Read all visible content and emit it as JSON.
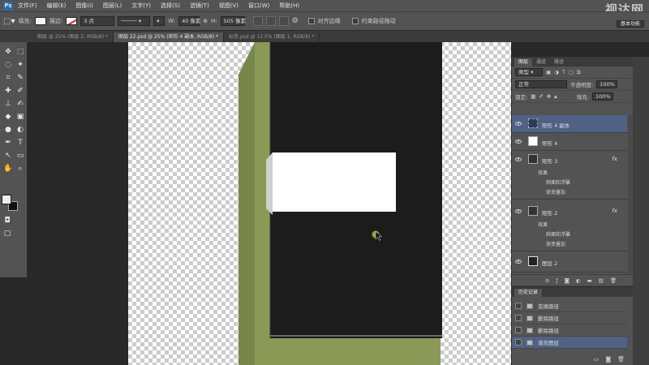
{
  "menu": {
    "logo": "Ps",
    "items": [
      "文件(F)",
      "编辑(E)",
      "图像(I)",
      "图层(L)",
      "文字(Y)",
      "选择(S)",
      "滤镜(T)",
      "视图(V)",
      "窗口(W)",
      "帮助(H)"
    ]
  },
  "watermark": "视达网",
  "options": {
    "fill_label": "填充:",
    "stroke_label": "描边:",
    "stroke_size": "3 点",
    "w_label": "W:",
    "w_value": "40 像素",
    "h_label": "H:",
    "h_value": "505 像素",
    "align_edges": "对齐边缘",
    "constrain_path": "约束路径拖动",
    "workspace": "基本功能"
  },
  "tabs": [
    "图层 @ 25% (图层 2, RGB/8) *",
    "图层 22.psd @ 25% (矩形 4 副本, RGB/8) *",
    "标签.psd @ 12.5% (图层 1, RGB/8) *"
  ],
  "layers_panel": {
    "tabs": [
      "图层",
      "通道",
      "路径"
    ],
    "kind_filter": "类型",
    "blend_mode": "正常",
    "opacity_label": "不透明度:",
    "opacity_value": "100%",
    "lock_label": "锁定:",
    "fill_label": "填充:",
    "fill_value": "100%",
    "fx_mark": "fx",
    "layers": [
      {
        "name": "矩形 4 副本"
      },
      {
        "name": "矩形 4"
      },
      {
        "name": "矩形 3",
        "effects_label": "效果",
        "effects": [
          "斜面和浮雕",
          "渐变叠加"
        ]
      },
      {
        "name": "矩形 2",
        "effects_label": "效果",
        "effects": [
          "斜面和浮雕",
          "渐变叠加"
        ]
      },
      {
        "name": "图层 2"
      }
    ]
  },
  "history_panel": {
    "title": "历史记录",
    "items": [
      "变换路径",
      "删除路径",
      "删除路径",
      "填充图层"
    ]
  },
  "colors": {
    "canvas_black": "#1c1c1c",
    "olive_green": "#8a9a56",
    "selection_blue": "#4f6285",
    "cursor_green": "#9aa627"
  }
}
